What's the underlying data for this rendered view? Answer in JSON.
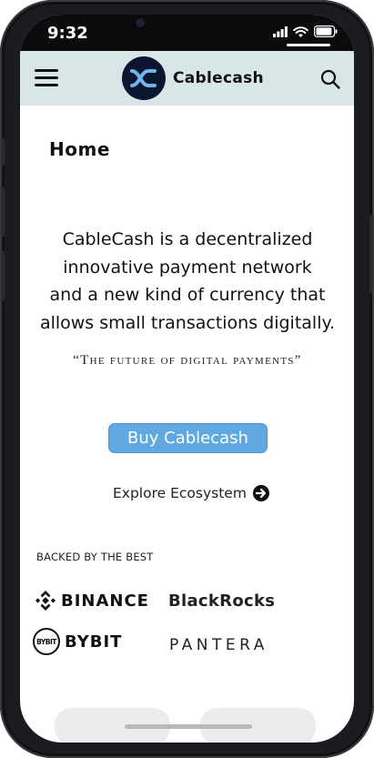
{
  "status_bar": {
    "time": "9:32"
  },
  "app_bar": {
    "brand_name": "Cablecash"
  },
  "page": {
    "title": "Home",
    "intro_lines": [
      "CableCash is a decentralized",
      "innovative payment network",
      "and a new kind of currency that",
      "allows small transactions digitally."
    ],
    "tagline": "“The future of digital payments”",
    "buy_button_label": "Buy Cablecash",
    "explore_label": "Explore Ecosystem"
  },
  "backers": {
    "heading": "BACKED BY THE BEST",
    "partners": [
      "BINANCE",
      "BlackRocks",
      "BYBIT",
      "PANTERA"
    ],
    "bybit_mark": "BYBIT"
  },
  "icons": [
    "hamburger-menu-icon",
    "cablecash-logo-icon",
    "search-icon",
    "signal-icon",
    "wifi-icon",
    "battery-icon",
    "arrow-circle-right-icon",
    "binance-logo-icon",
    "bybit-logo-icon"
  ],
  "colors": {
    "app_bar_bg": "#d8e6e7",
    "logo_bg": "#0d1530",
    "logo_accent": "#6fb6f0",
    "button_bg": "#5fa8e1",
    "text": "#111111"
  }
}
